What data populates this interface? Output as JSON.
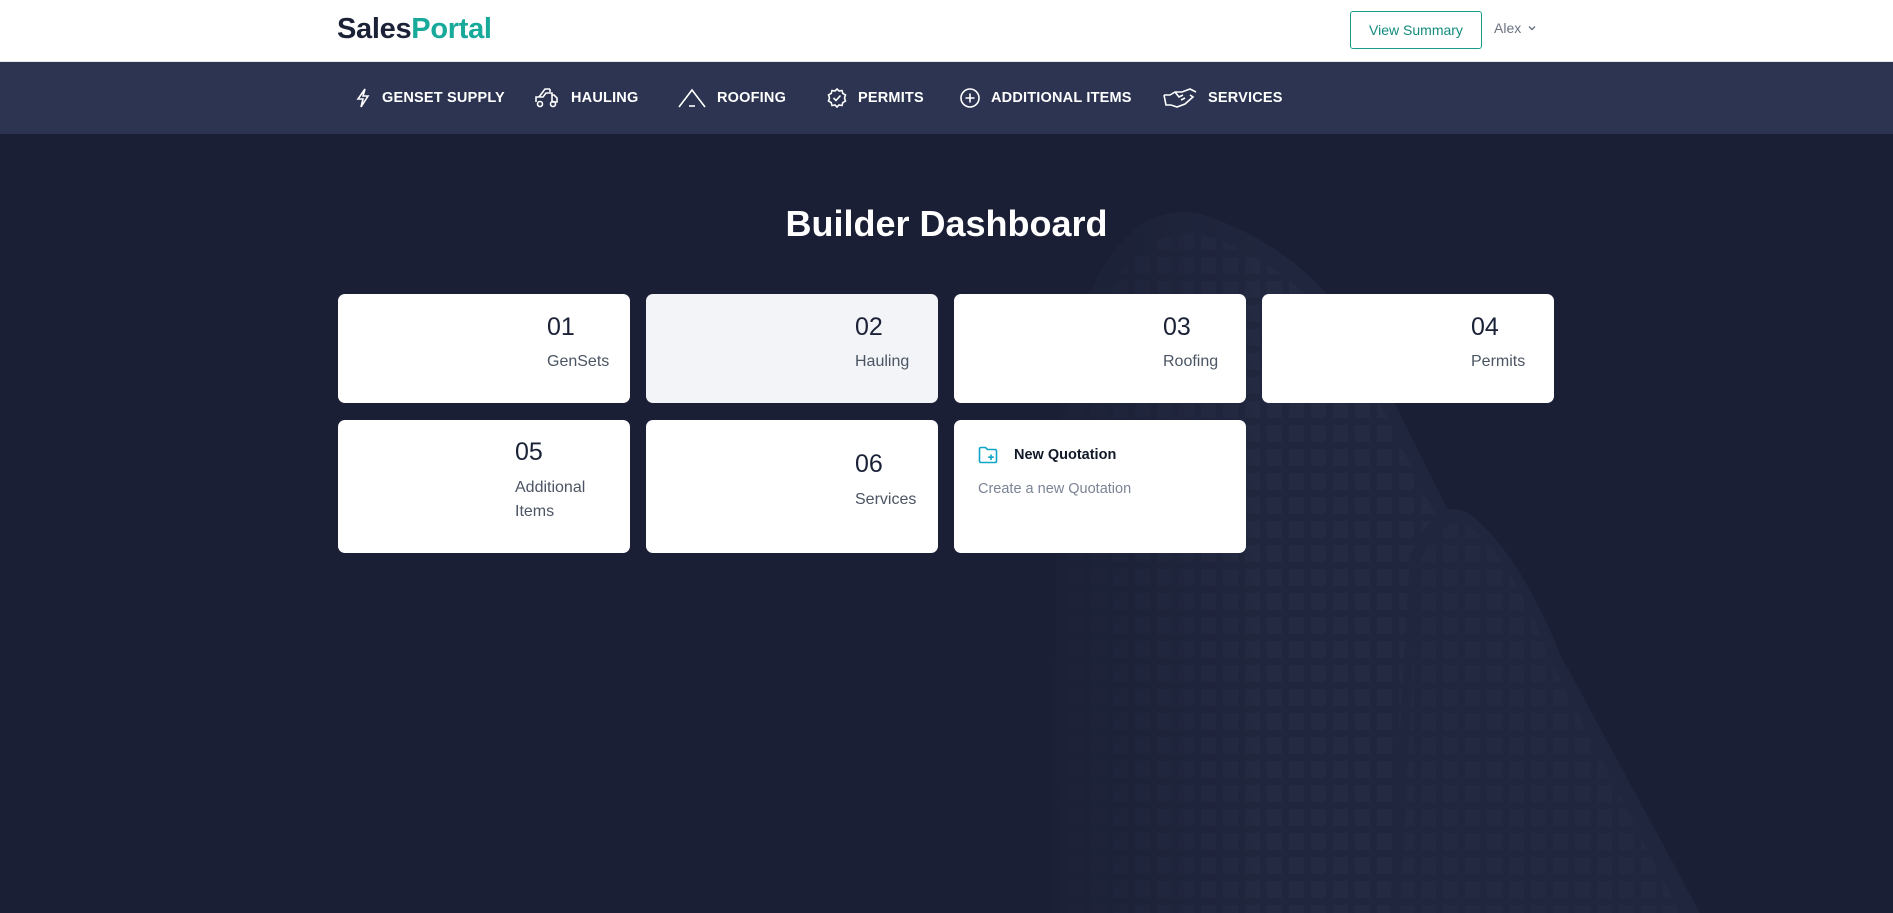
{
  "header": {
    "logo_part1": "Sales",
    "logo_part2": "Portal",
    "view_summary_label": "View Summary",
    "user_name": "Alex"
  },
  "nav": {
    "items": [
      {
        "label": "GENSET SUPPLY",
        "icon": "bolt-icon"
      },
      {
        "label": "HAULING",
        "icon": "tow-truck-icon"
      },
      {
        "label": "ROOFING",
        "icon": "roof-icon"
      },
      {
        "label": "PERMITS",
        "icon": "badge-check-icon"
      },
      {
        "label": "ADDITIONAL ITEMS",
        "icon": "plus-circle-icon"
      },
      {
        "label": "SERVICES",
        "icon": "handshake-icon"
      }
    ]
  },
  "main": {
    "title": "Builder Dashboard",
    "cards": [
      {
        "number": "01",
        "label": "GenSets"
      },
      {
        "number": "02",
        "label": "Hauling"
      },
      {
        "number": "03",
        "label": "Roofing"
      },
      {
        "number": "04",
        "label": "Permits"
      },
      {
        "number": "05",
        "label": "Additional Items"
      },
      {
        "number": "06",
        "label": "Services"
      }
    ],
    "new_quotation": {
      "title": "New Quotation",
      "subtitle": "Create a new Quotation",
      "icon": "folder-plus-icon"
    }
  },
  "colors": {
    "brand_dark": "#1b2238",
    "brand_accent": "#17a99a",
    "page_background": "#1a1f35",
    "nav_background": "#2c3452"
  }
}
